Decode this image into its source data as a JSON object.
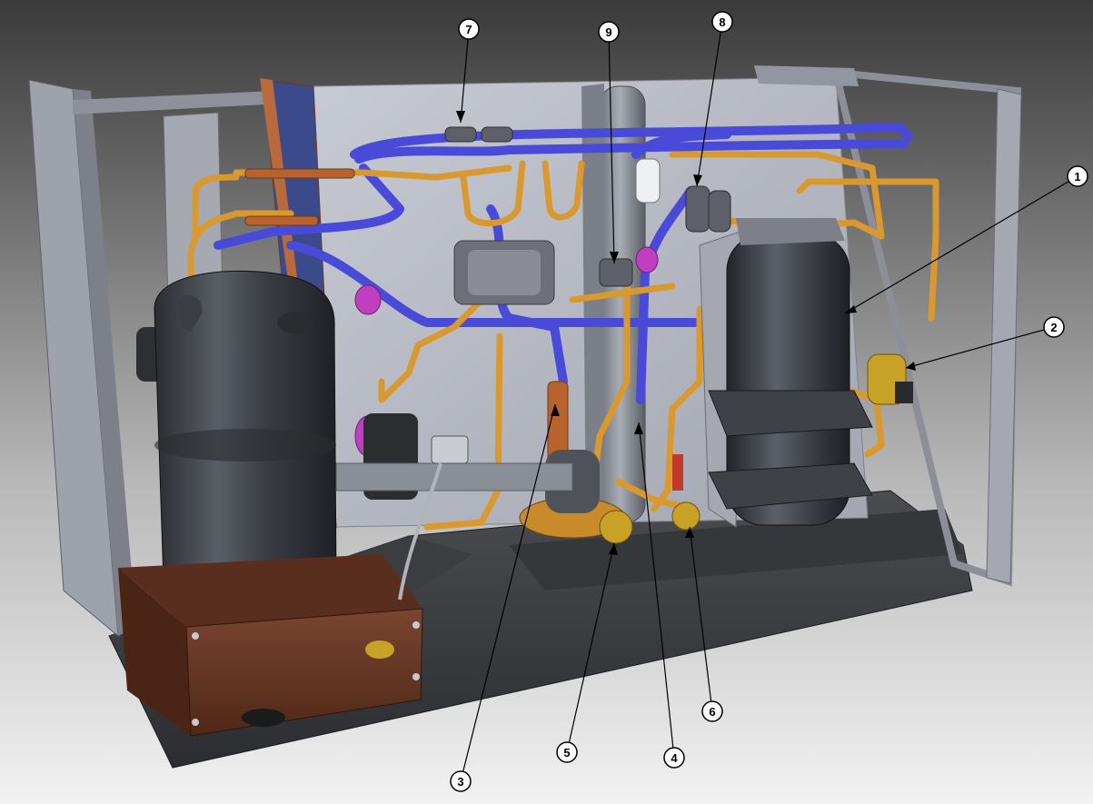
{
  "diagram": {
    "callouts": [
      {
        "id": "callout-1",
        "label": "1"
      },
      {
        "id": "callout-2",
        "label": "2"
      },
      {
        "id": "callout-3",
        "label": "3"
      },
      {
        "id": "callout-4",
        "label": "4"
      },
      {
        "id": "callout-5",
        "label": "5"
      },
      {
        "id": "callout-6",
        "label": "6"
      },
      {
        "id": "callout-7",
        "label": "7"
      },
      {
        "id": "callout-8",
        "label": "8"
      },
      {
        "id": "callout-9",
        "label": "9"
      }
    ],
    "colors": {
      "copper_pipe": "#d9992e",
      "insulated_pipe": "#4a4ad8",
      "compressor": "#3c3f44",
      "frame": "#9a9ea6",
      "back_panel": "#b9bcc6",
      "base_bracket": "#6e3a26",
      "brass": "#c8a227",
      "valve_magenta": "#c03ec0"
    }
  }
}
